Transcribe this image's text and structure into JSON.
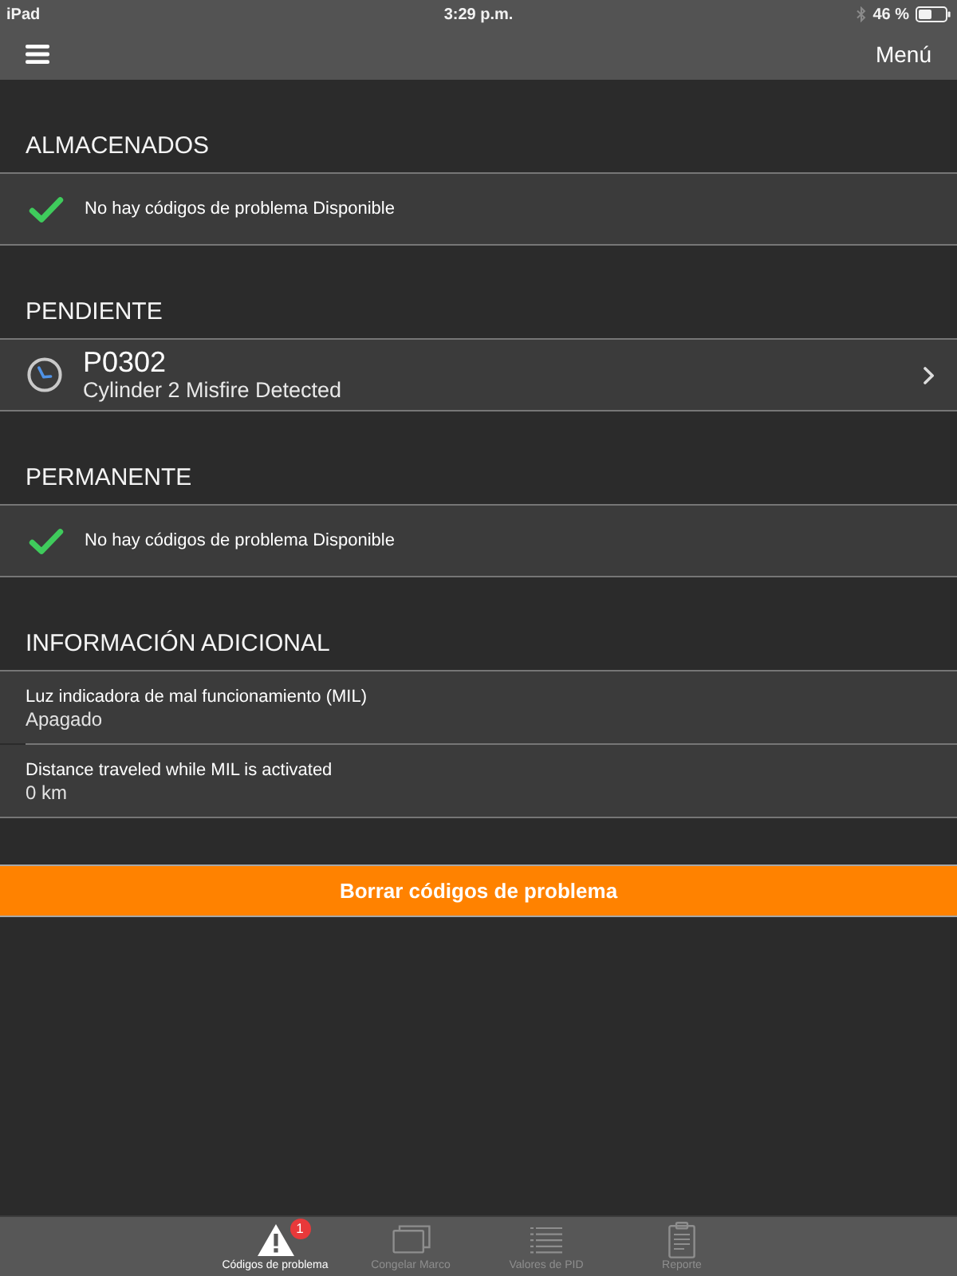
{
  "status_bar": {
    "device": "iPad",
    "time": "3:29 p.m.",
    "battery": "46 %"
  },
  "nav_bar": {
    "menu_label": "Menú"
  },
  "sections": [
    {
      "title": "ALMACENADOS",
      "rows": [
        {
          "kind": "status",
          "text": "No hay códigos de problema Disponible"
        }
      ]
    },
    {
      "title": "PENDIENTE",
      "rows": [
        {
          "kind": "code",
          "code": "P0302",
          "description": "Cylinder 2 Misfire Detected"
        }
      ]
    },
    {
      "title": "PERMANENTE",
      "rows": [
        {
          "kind": "status",
          "text": "No hay códigos de problema Disponible"
        }
      ]
    },
    {
      "title": "INFORMACIÓN ADICIONAL",
      "rows": [
        {
          "kind": "info",
          "label": "Luz indicadora de mal funcionamiento (MIL)",
          "value": "Apagado"
        },
        {
          "kind": "info",
          "label": "Distance traveled while MIL is activated",
          "value": "0 km"
        }
      ]
    }
  ],
  "action_button": {
    "label": "Borrar códigos de problema"
  },
  "tab_bar": {
    "tabs": [
      {
        "label": "Códigos de problema",
        "selected": true,
        "badge": "1"
      },
      {
        "label": "Congelar Marco",
        "selected": false
      },
      {
        "label": "Valores de PID",
        "selected": false
      },
      {
        "label": "Reporte",
        "selected": false
      }
    ]
  }
}
